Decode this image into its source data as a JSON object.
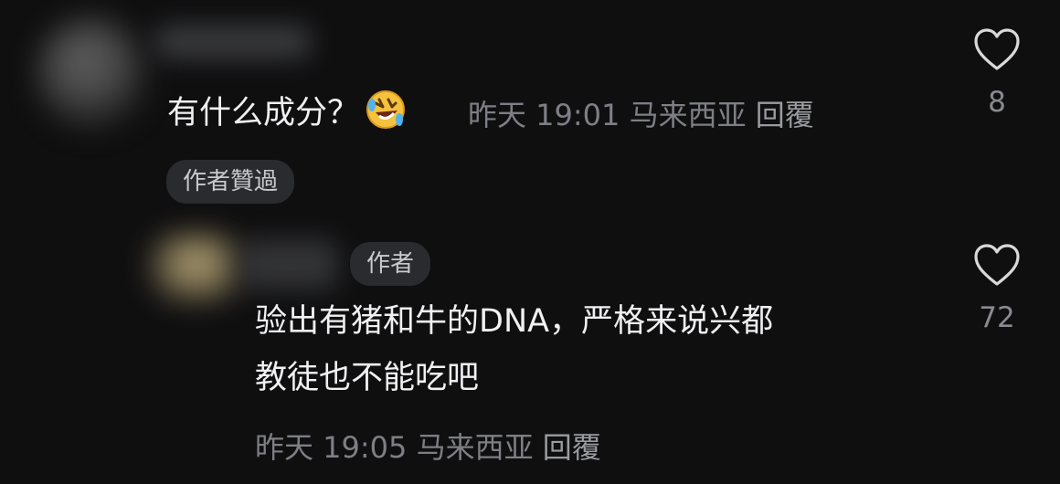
{
  "comment1": {
    "text": "有什么成分？",
    "emoji_icon": "rolling-on-floor-laughing-emoji",
    "time": "昨天 19:01",
    "location": "马来西亚",
    "reply_label": "回覆",
    "author_liked_badge": "作者贊過",
    "likes": "8"
  },
  "comment2": {
    "author_badge": "作者",
    "text_line1": "验出有猪和牛的DNA，严格来说兴都",
    "text_line2": "教徒也不能吃吧",
    "time": "昨天 19:05",
    "location": "马来西亚",
    "reply_label": "回覆",
    "likes": "72"
  },
  "colors": {
    "background": "#0f0f10",
    "text": "#f0f0f2",
    "meta": "#7e7f85",
    "pill": "#2a2b2e"
  }
}
